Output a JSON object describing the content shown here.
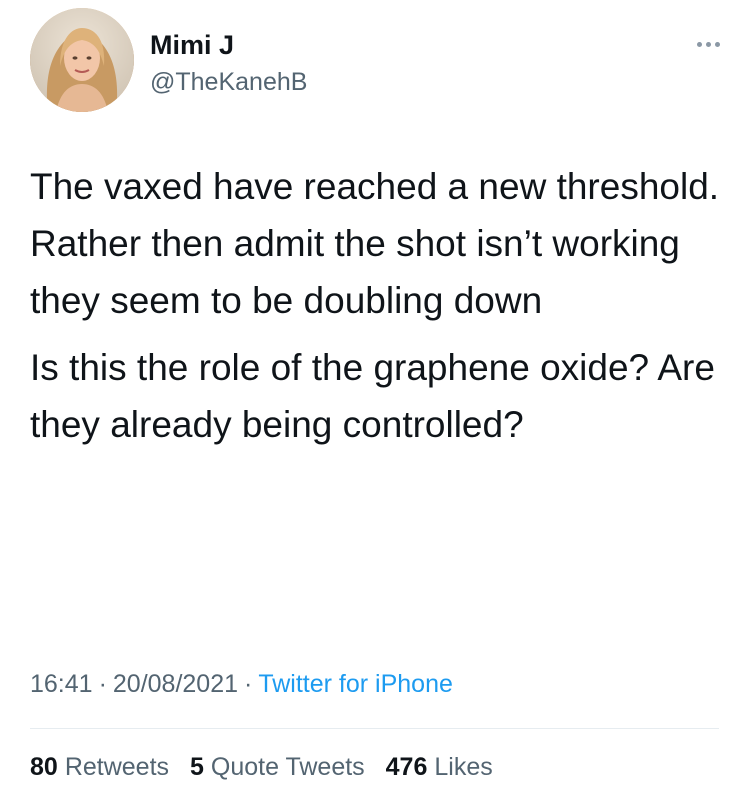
{
  "author": {
    "name": "Mimi J",
    "handle": "@TheKanehB"
  },
  "tweet": {
    "paragraphs": [
      "The vaxed have reached a new threshold.\nRather then admit the shot isn’t working they seem to be doubling down",
      "Is this the role of the graphene oxide? Are they already being controlled?"
    ]
  },
  "meta": {
    "time": "16:41",
    "date": "20/08/2021",
    "source": "Twitter for iPhone",
    "separator": "·"
  },
  "stats": {
    "retweets_count": "80",
    "retweets_label": "Retweets",
    "quotes_count": "5",
    "quotes_label": "Quote Tweets",
    "likes_count": "476",
    "likes_label": "Likes"
  },
  "icons": {
    "more": "more-horizontal-icon"
  },
  "colors": {
    "text": "#0f1419",
    "secondary": "#536471",
    "link": "#1d9bf0",
    "divider": "#e6ecf0"
  }
}
